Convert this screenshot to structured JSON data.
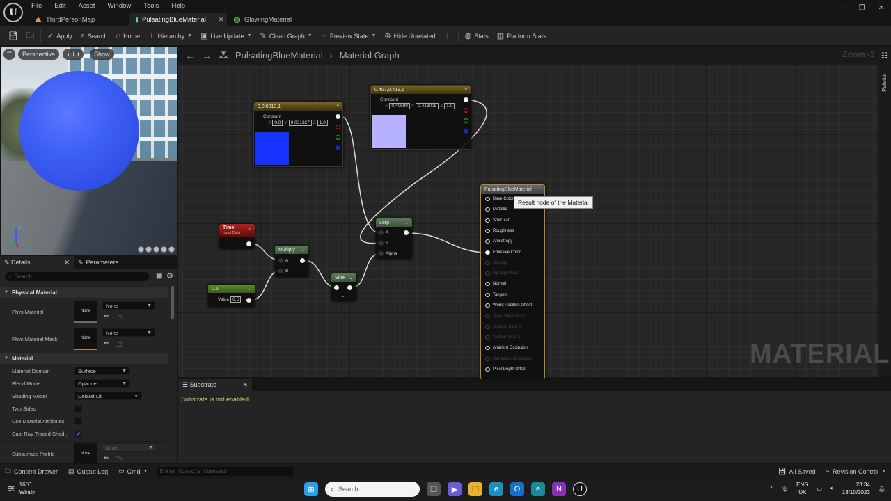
{
  "app": {
    "menu": [
      "File",
      "Edit",
      "Asset",
      "Window",
      "Tools",
      "Help"
    ],
    "tabs": [
      {
        "label": "ThirdPersonMap",
        "icon": "level-icon",
        "active": false
      },
      {
        "label": "PulsatingBlueMaterial",
        "icon": "material-icon",
        "active": true
      },
      {
        "label": "GlowingMaterial",
        "icon": "material-icon",
        "active": false
      }
    ],
    "window_controls": {
      "minimize": "—",
      "maximize": "❐",
      "close": "✕"
    }
  },
  "toolbar": {
    "apply": "Apply",
    "search": "Search",
    "home": "Home",
    "hierarchy": "Hierarchy",
    "live_update": "Live Update",
    "clean_graph": "Clean Graph",
    "preview_state": "Preview State",
    "hide_unrelated": "Hide Unrelated",
    "stats": "Stats",
    "platform_stats": "Platform Stats"
  },
  "viewport": {
    "perspective": "Perspective",
    "lit": "Lit",
    "show": "Show",
    "axis_z": "Z"
  },
  "details": {
    "tab_details": "Details",
    "tab_parameters": "Parameters",
    "search_placeholder": "Search",
    "section_physical": "Physical Material",
    "phys_material": "Phys Material",
    "phys_material_value": "None",
    "thumb_none": "None",
    "phys_material_mask": "Phys Material Mask",
    "phys_material_mask_value": "None",
    "section_material": "Material",
    "material_domain": "Material Domain",
    "material_domain_value": "Surface",
    "blend_mode": "Blend Mode",
    "blend_mode_value": "Opaque",
    "shading_model": "Shading Model",
    "shading_model_value": "Default Lit",
    "two_sided": "Two Sided",
    "two_sided_checked": false,
    "use_material_attributes": "Use Material Attributes",
    "use_material_attributes_checked": false,
    "cast_ray_traced": "Cast Ray Traced Shad...",
    "cast_ray_traced_checked": true,
    "subsurface_profile": "Subsurface Profile",
    "subsurface_profile_value": "None"
  },
  "graph": {
    "breadcrumb_root": "PulsatingBlueMaterial",
    "breadcrumb_child": "Material Graph",
    "zoom": "Zoom -2",
    "palette": "Palette",
    "watermark": "MATERIAL",
    "tooltip": "Result node of the Material",
    "nodes": {
      "const1": {
        "title": "0,0.0313,1",
        "subtitle": "Constant",
        "x": "0.0",
        "y": "0.031327",
        "z": "1.0",
        "color": "#1633ff"
      },
      "const2": {
        "title": "0.407,0.413,1",
        "subtitle": "Constant",
        "x": "0.40689",
        "y": "0.413005",
        "z": "1.0",
        "color": "#b6b2ff"
      },
      "time": {
        "title": "Time",
        "subtitle": "Input Data"
      },
      "scalar": {
        "title": "0.5",
        "value_label": "Value",
        "value": "0.5"
      },
      "multiply": {
        "title": "Multiply",
        "pin_a": "A",
        "pin_b": "B"
      },
      "sine": {
        "title": "Sine"
      },
      "lerp": {
        "title": "Lerp",
        "pin_a": "A",
        "pin_b": "B",
        "pin_alpha": "Alpha"
      },
      "result": {
        "title": "PulsatingBlueMaterial",
        "pins": [
          {
            "label": "Base Color",
            "state": "enabled"
          },
          {
            "label": "Metallic",
            "state": "enabled"
          },
          {
            "label": "Specular",
            "state": "enabled"
          },
          {
            "label": "Roughness",
            "state": "enabled"
          },
          {
            "label": "Anisotropy",
            "state": "enabled"
          },
          {
            "label": "Emissive Color",
            "state": "connected"
          },
          {
            "label": "Opacity",
            "state": "disabled"
          },
          {
            "label": "Opacity Mask",
            "state": "disabled"
          },
          {
            "label": "Normal",
            "state": "enabled"
          },
          {
            "label": "Tangent",
            "state": "enabled"
          },
          {
            "label": "World Position Offset",
            "state": "enabled"
          },
          {
            "label": "Subsurface Color",
            "state": "disabled"
          },
          {
            "label": "Custom Data 0",
            "state": "disabled"
          },
          {
            "label": "Custom Data 1",
            "state": "disabled"
          },
          {
            "label": "Ambient Occlusion",
            "state": "enabled"
          },
          {
            "label": "Refraction (Disabled)",
            "state": "disabled"
          },
          {
            "label": "Pixel Depth Offset",
            "state": "enabled"
          }
        ]
      }
    }
  },
  "substrate": {
    "tab": "Substrate",
    "message": "Substrate is not enabled."
  },
  "statusbar": {
    "content_drawer": "Content Drawer",
    "output_log": "Output Log",
    "cmd": "Cmd",
    "console_placeholder": "Enter Console Command",
    "all_saved": "All Saved",
    "revision_control": "Revision Control"
  },
  "taskbar": {
    "weather_temp": "16°C",
    "weather_desc": "Windy",
    "search": "Search",
    "lang_top": "ENG",
    "lang_bottom": "UK",
    "time": "23:34",
    "date": "18/10/2023"
  }
}
